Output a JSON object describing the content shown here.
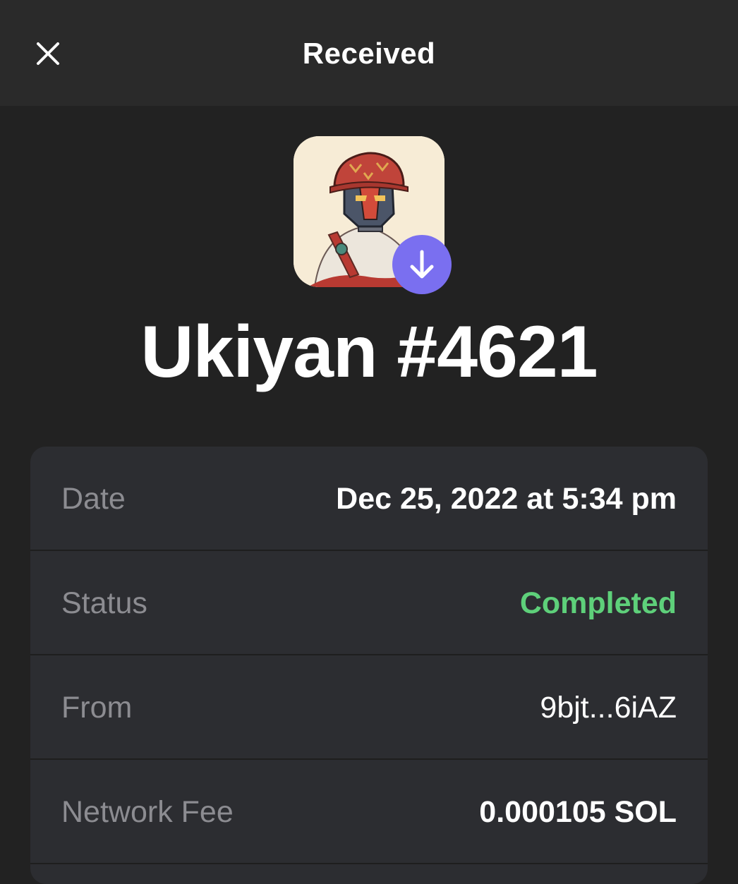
{
  "header": {
    "title": "Received",
    "close_icon": "close-icon"
  },
  "nft": {
    "name": "Ukiyan #4621",
    "badge_icon": "arrow-down-icon",
    "badge_color": "#7a6ff0"
  },
  "details": [
    {
      "label": "Date",
      "value": "Dec 25, 2022 at 5:34 pm"
    },
    {
      "label": "Status",
      "value": "Completed",
      "value_color": "#5ed07a"
    },
    {
      "label": "From",
      "value": "9bjt...6iAZ"
    },
    {
      "label": "Network Fee",
      "value": "0.000105 SOL"
    }
  ]
}
